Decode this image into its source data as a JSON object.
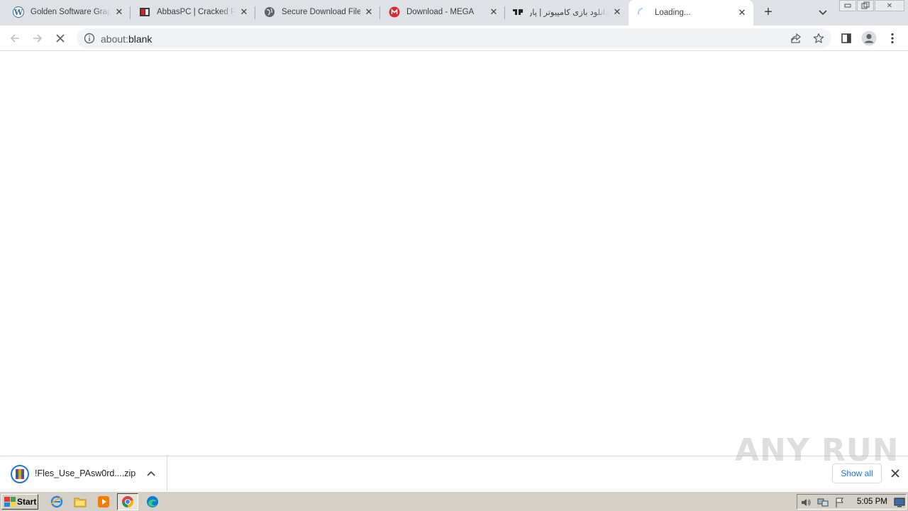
{
  "tabs": [
    {
      "title": "Golden Software Graph",
      "favicon": "wordpress-icon"
    },
    {
      "title": "AbbasPC | Cracked PC",
      "favicon": "abbaspc-icon"
    },
    {
      "title": "Secure Download File",
      "favicon": "globe-icon"
    },
    {
      "title": "Download - MEGA",
      "favicon": "mega-icon"
    },
    {
      "title": "دانلود بازی کامپیوتر | پار",
      "favicon": "parsi-icon"
    },
    {
      "title": "Loading...",
      "favicon": "loading-spinner-icon",
      "active": true
    }
  ],
  "address_bar": {
    "scheme": "about:",
    "rest": "blank"
  },
  "download_shelf": {
    "file_name": "!Fles_Use_PAsw0rd....zip",
    "show_all_label": "Show all",
    "watermark": "ANY RUN"
  },
  "taskbar": {
    "start_label": "Start",
    "clock": "5:05 PM"
  },
  "colors": {
    "tab_strip": "#dee1e6",
    "omnibox": "#f1f3f4",
    "link_blue": "#1a73e8",
    "taskbar": "#d4d0c8"
  }
}
